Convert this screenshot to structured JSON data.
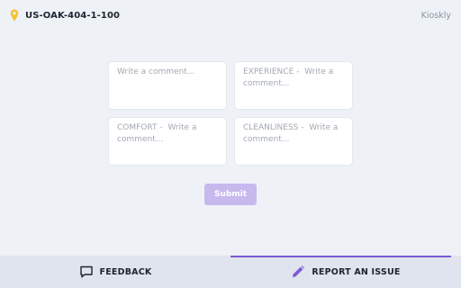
{
  "header": {
    "device_id": "US-OAK-404-1-100",
    "brand": "Kioskly",
    "pin_icon": "location-pin-icon",
    "pin_color": "#f2c230"
  },
  "form": {
    "fields": [
      {
        "placeholder": "Write a comment..."
      },
      {
        "placeholder": "EXPERIENCE -  Write a comment..."
      },
      {
        "placeholder": "COMFORT -  Write a comment..."
      },
      {
        "placeholder": "CLEANLINESS -  Write a comment..."
      }
    ],
    "submit_label": "Submit",
    "submit_color": "#c7b9ee"
  },
  "tabs": [
    {
      "label": "FEEDBACK",
      "icon": "message-icon",
      "active": false
    },
    {
      "label": "REPORT AN ISSUE",
      "icon": "pencil-icon",
      "active": true
    }
  ],
  "colors": {
    "accent": "#7b5ad6",
    "background": "#eef2f7",
    "tabbar": "#dfe4ee"
  }
}
